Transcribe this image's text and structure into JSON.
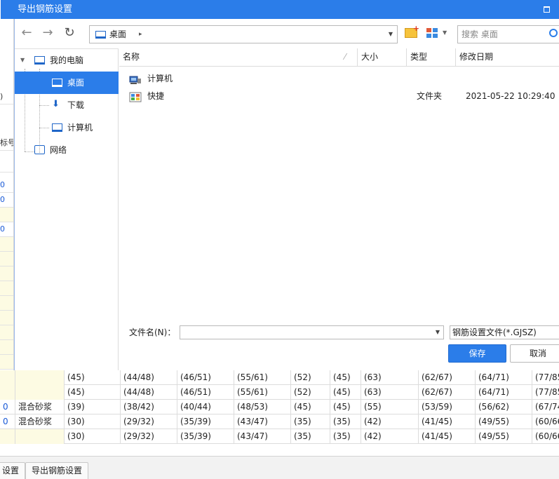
{
  "background": {
    "left_cells": [
      ")",
      "标号",
      "0",
      "0",
      "0"
    ],
    "bottom_tabs": [
      "设置",
      "导出钢筋设置"
    ],
    "table_rows": [
      [
        "",
        "",
        "(45)",
        "(44/48)",
        "(46/51)",
        "(55/61)",
        "(52)",
        "(45)",
        "(63)",
        "(62/67)",
        "(64/71)",
        "(77/85"
      ],
      [
        "",
        "",
        "(45)",
        "(44/48)",
        "(46/51)",
        "(55/61)",
        "(52)",
        "(45)",
        "(63)",
        "(62/67)",
        "(64/71)",
        "(77/85"
      ],
      [
        "0",
        "混合砂浆",
        "(39)",
        "(38/42)",
        "(40/44)",
        "(48/53)",
        "(45)",
        "(45)",
        "(55)",
        "(53/59)",
        "(56/62)",
        "(67/74"
      ],
      [
        "0",
        "混合砂浆",
        "(30)",
        "(29/32)",
        "(35/39)",
        "(43/47)",
        "(35)",
        "(35)",
        "(42)",
        "(41/45)",
        "(49/55)",
        "(60/66"
      ],
      [
        "",
        "",
        "(30)",
        "(29/32)",
        "(35/39)",
        "(43/47)",
        "(35)",
        "(35)",
        "(42)",
        "(41/45)",
        "(49/55)",
        "(60/66"
      ]
    ]
  },
  "dialog": {
    "title": "导出钢筋设置",
    "address": {
      "location": "桌面"
    },
    "search": {
      "placeholder": "搜索 桌面"
    },
    "tree": {
      "my_computer": "我的电脑",
      "desktop": "桌面",
      "downloads": "下载",
      "computer": "计算机",
      "network": "网络"
    },
    "columns": {
      "name": "名称",
      "size": "大小",
      "type": "类型",
      "modified": "修改日期"
    },
    "files": [
      {
        "name": "计算机",
        "type": "",
        "date": ""
      },
      {
        "name": "快捷",
        "type": "文件夹",
        "date": "2021-05-22 10:29:40"
      }
    ],
    "filename_label": "文件名(N)：",
    "filename_value": "",
    "filetype": "钢筋设置文件(*.GJSZ)",
    "save_label": "保存",
    "cancel_label": "取消"
  },
  "colors": {
    "accent": "#2b7de9",
    "selection": "#2b7de9",
    "highlight_yellow": "#fdfbe3"
  }
}
